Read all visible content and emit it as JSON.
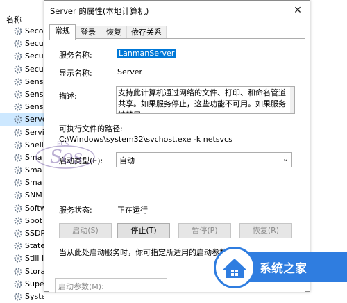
{
  "services_list": {
    "header": "名称",
    "rows": [
      "Seco",
      "Secu",
      "Secu",
      "Secu",
      "Sens",
      "Sens",
      "Sens",
      "Serve",
      "Servi",
      "Shell",
      "Sma",
      "Sma",
      "Sma",
      "SNM",
      "Softw",
      "Spot",
      "SSDP",
      "State",
      "Still I",
      "Stora",
      "Supe",
      "Syste"
    ],
    "selected_index": 7
  },
  "dialog": {
    "title": "Server 的属性(本地计算机)",
    "close_icon": "close-icon",
    "tabs": [
      "常规",
      "登录",
      "恢复",
      "依存关系"
    ],
    "active_tab": 0,
    "service_name_label": "服务名称:",
    "service_name": "LanmanServer",
    "display_name_label": "显示名称:",
    "display_name": "Server",
    "description_label": "描述:",
    "description": "支持此计算机通过网络的文件、打印、和命名管道共享。如果服务停止，这些功能不可用。如果服务被禁用，",
    "exe_path_label": "可执行文件的路径:",
    "exe_path": "C:\\Windows\\system32\\svchost.exe -k netsvcs",
    "startup_type_label": "启动类型(E):",
    "startup_type": "自动",
    "service_status_label": "服务状态:",
    "service_status": "正在运行",
    "buttons": {
      "start": "启动(S)",
      "stop": "停止(T)",
      "pause": "暂停(P)",
      "resume": "恢复(R)"
    },
    "hint": "当从此处启动服务时，你可指定所适用的启动参数。",
    "start_params_label": "启动参数(M):"
  },
  "watermark": {
    "logo_text": "系统之家",
    "left_text": "PCS"
  },
  "colors": {
    "selection": "#0078d7",
    "list_selected": "#cde8ff",
    "logo_blue": "#2f7de0"
  }
}
